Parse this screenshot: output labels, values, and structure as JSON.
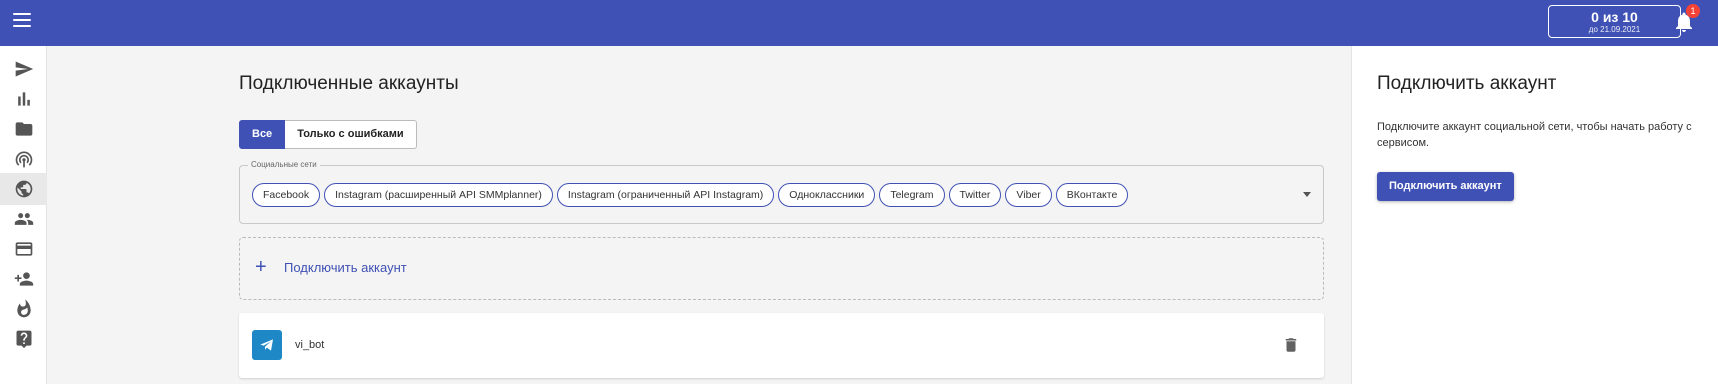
{
  "header": {
    "counter_main": "0 из 10",
    "counter_sub": "до 21.09.2021",
    "notification_count": "1"
  },
  "sidebar": {
    "items": [
      {
        "icon": "send-icon"
      },
      {
        "icon": "bar-chart-icon"
      },
      {
        "icon": "folder-icon"
      },
      {
        "icon": "podcast-icon"
      },
      {
        "icon": "globe-icon",
        "active": true
      },
      {
        "icon": "people-icon"
      },
      {
        "icon": "credit-card-icon"
      },
      {
        "icon": "add-user-icon"
      },
      {
        "icon": "fire-icon"
      },
      {
        "icon": "help-icon"
      }
    ]
  },
  "main": {
    "title": "Подключенные аккаунты",
    "tabs": [
      {
        "label": "Все",
        "active": true
      },
      {
        "label": "Только с ошибками",
        "active": false
      }
    ],
    "filter": {
      "legend": "Социальные сети",
      "chips": [
        "Facebook",
        "Instagram (расширенный API SMMplanner)",
        "Instagram (ограниченный API Instagram)",
        "Одноклассники",
        "Telegram",
        "Twitter",
        "Viber",
        "ВКонтакте"
      ]
    },
    "add_account": {
      "plus": "+",
      "label": "Подключить аккаунт"
    },
    "accounts": [
      {
        "network": "telegram",
        "name": "vi_bot"
      }
    ]
  },
  "right_panel": {
    "title": "Подключить аккаунт",
    "description": "Подключите аккаунт социальной сети, чтобы начать работу с сервисом.",
    "button": "Подключить аккаунт"
  },
  "colors": {
    "primary": "#3f51b5",
    "telegram": "#1e88c7",
    "badge": "#f44336"
  }
}
